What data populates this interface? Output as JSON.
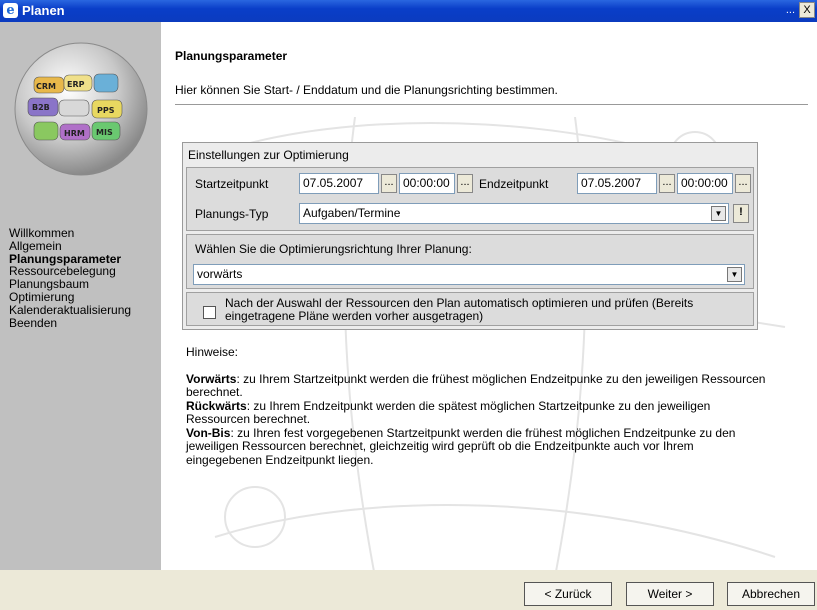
{
  "window": {
    "title": "Planen",
    "close_label": "X",
    "overflow_label": "..."
  },
  "logo_labels": [
    "CRM",
    "ERP",
    "B2B",
    "PPS",
    "HRM",
    "MIS"
  ],
  "sidebar": {
    "items": [
      {
        "label": "Willkommen",
        "active": false
      },
      {
        "label": "Allgemein",
        "active": false
      },
      {
        "label": "Planungsparameter",
        "active": true
      },
      {
        "label": "Ressourcebelegung",
        "active": false
      },
      {
        "label": "Planungsbaum",
        "active": false
      },
      {
        "label": "Optimierung",
        "active": false
      },
      {
        "label": "Kalenderaktualisierung",
        "active": false
      },
      {
        "label": "Beenden",
        "active": false
      }
    ]
  },
  "header": {
    "title": "Planungsparameter",
    "description": "Hier können Sie Start- / Enddatum und die Planungsrichting bestimmen."
  },
  "settings": {
    "group_title": "Einstellungen zur Optimierung",
    "start_label": "Startzeitpunkt",
    "start_date": "07.05.2007",
    "start_time": "00:00:00",
    "end_label": "Endzeitpunkt",
    "end_date": "07.05.2007",
    "end_time": "00:00:00",
    "ellipsis": "...",
    "type_label": "Planungs-Typ",
    "type_value": "Aufgaben/Termine",
    "type_extra_button": "!",
    "direction_prompt": "Wählen Sie die Optimierungsrichtung Ihrer Planung:",
    "direction_value": "vorwärts",
    "auto_optimize_label": "Nach der Auswahl der Ressourcen den Plan automatisch optimieren und prüfen (Bereits eingetragene Pläne werden vorher ausgetragen)",
    "auto_optimize_checked": false
  },
  "hints": {
    "title": "Hinweise:",
    "forward_term": "Vorwärts",
    "forward_text": ": zu Ihrem Startzeitpunkt werden die frühest möglichen Endzeitpunke zu den jeweiligen Ressourcen berechnet.",
    "backward_term": "Rückwärts",
    "backward_text": ": zu Ihrem Endzeitpunkt werden die spätest möglichen Startzeitpunke zu den jeweiligen Ressourcen berechnet.",
    "fromto_term": "Von-Bis",
    "fromto_text": ": zu Ihren fest vorgegebenen Startzeitpunkt werden die frühest möglichen Endzeitpunke zu den jeweiligen Ressourcen berechnet, gleichzeitig wird geprüft ob die Endzeitpunkte auch vor Ihrem eingegebenen Endzeitpunkt liegen."
  },
  "footer": {
    "back_label": "< Zurück",
    "next_label": "Weiter >",
    "cancel_label": "Abbrechen"
  }
}
